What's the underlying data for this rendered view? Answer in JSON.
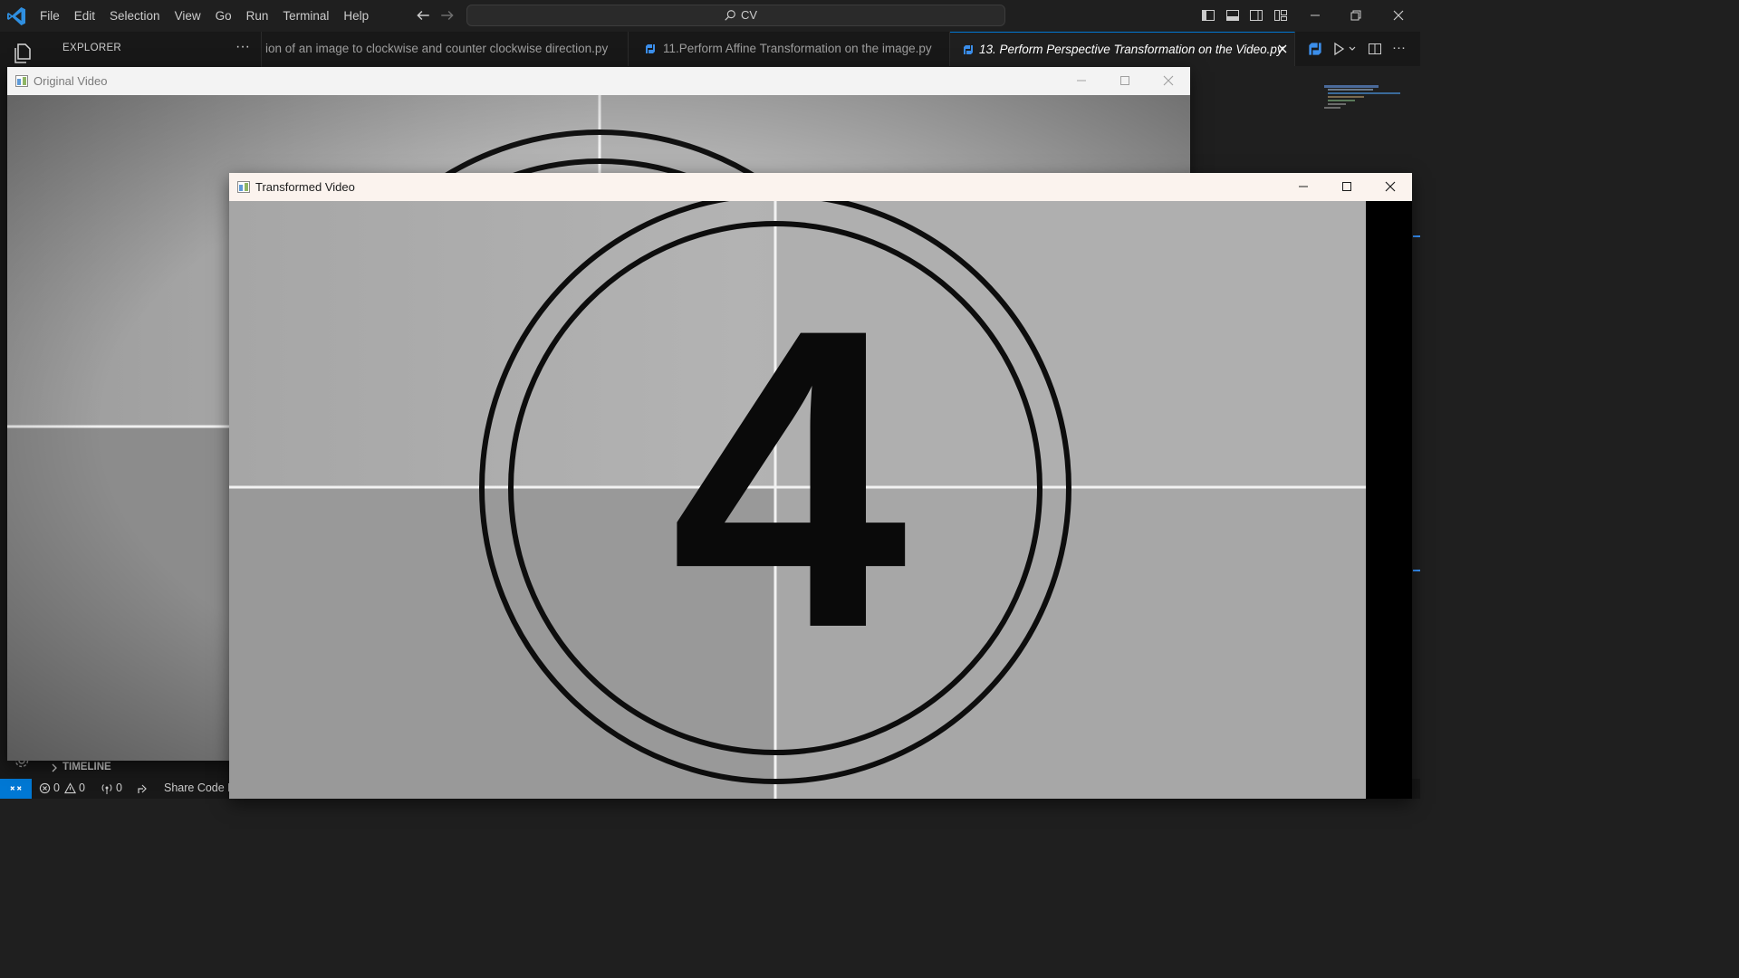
{
  "titlebar": {
    "menu": [
      "File",
      "Edit",
      "Selection",
      "View",
      "Go",
      "Run",
      "Terminal",
      "Help"
    ],
    "command_center": "CV"
  },
  "sidebar": {
    "title": "EXPLORER",
    "more": "···",
    "timeline": "TIMELINE"
  },
  "tabs": [
    {
      "label": "ion of an image to clockwise and counter clockwise direction.py",
      "active": false
    },
    {
      "label": "11.Perform Affine Transformation on the image.py",
      "active": false
    },
    {
      "label": "13.  Perform Perspective Transformation on the Video.py",
      "active": true
    }
  ],
  "statusbar": {
    "errors": "0",
    "warnings": "0",
    "ports": "0",
    "share": "Share Code L"
  },
  "windows": {
    "original": {
      "title": "Original Video"
    },
    "transformed": {
      "title": "Transformed Video",
      "countdown_number": "4"
    }
  },
  "colors": {
    "accent": "#0078d4",
    "python_icon": "#3b8eea",
    "film_gray": "#a9a9a9"
  }
}
